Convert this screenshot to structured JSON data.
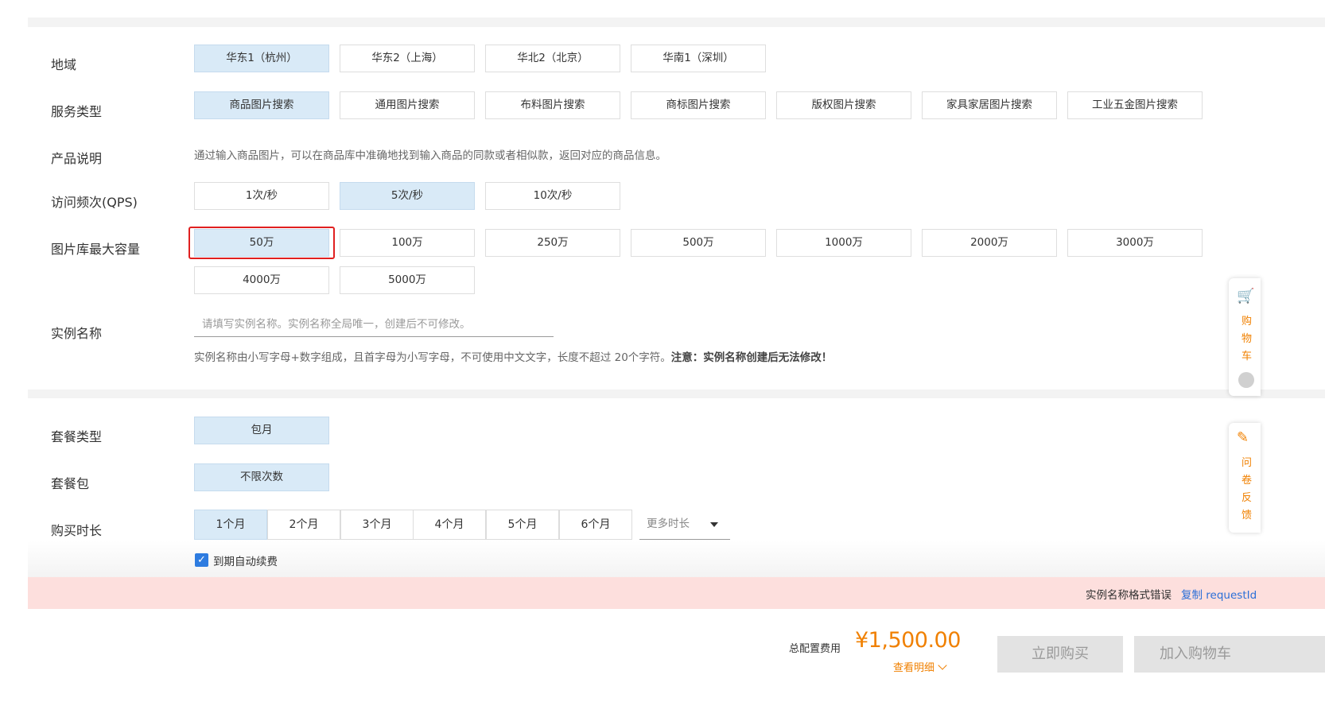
{
  "labels": {
    "region": "地域",
    "service_type": "服务类型",
    "product_desc": "产品说明",
    "qps": "访问频次(QPS)",
    "capacity": "图片库最大容量",
    "instance_name": "实例名称",
    "package_type": "套餐类型",
    "package": "套餐包",
    "duration": "购买时长"
  },
  "regions": [
    "华东1（杭州）",
    "华东2（上海）",
    "华北2（北京）",
    "华南1（深圳）"
  ],
  "service_types": [
    "商品图片搜索",
    "通用图片搜索",
    "布料图片搜索",
    "商标图片搜索",
    "版权图片搜索",
    "家具家居图片搜索",
    "工业五金图片搜索"
  ],
  "product_desc_text": "通过输入商品图片，可以在商品库中准确地找到输入商品的同款或者相似款，返回对应的商品信息。",
  "qps_options": [
    "1次/秒",
    "5次/秒",
    "10次/秒"
  ],
  "capacities": [
    "50万",
    "100万",
    "250万",
    "500万",
    "1000万",
    "2000万",
    "3000万",
    "4000万",
    "5000万"
  ],
  "instance": {
    "placeholder": "请填写实例名称。实例名称全局唯一，创建后不可修改。",
    "hint": "实例名称由小写字母+数字组成，且首字母为小写字母，不可使用中文文字，长度不超过 20个字符。",
    "hint_bold": "注意：实例名称创建后无法修改！"
  },
  "package_type_value": "包月",
  "package_value": "不限次数",
  "durations": [
    "1个月",
    "2个月",
    "3个月",
    "4个月",
    "5个月",
    "6个月"
  ],
  "more_duration": "更多时长",
  "auto_renew": "到期自动续费",
  "error": {
    "message": "实例名称格式错误",
    "copy_link": "复制 requestId"
  },
  "footer": {
    "total_label": "总配置费用",
    "price": "¥1,500.00",
    "detail": "查看明细",
    "buy_now": "立即购买",
    "add_cart": "加入购物车"
  },
  "sidebar": {
    "cart_text": "购物车",
    "feedback_text": "问卷反馈"
  },
  "colors": {
    "selected_bg": "#d9eaf7",
    "accent_orange": "#f08000",
    "link_blue": "#2a6fd8",
    "error_bg": "#fddfdd",
    "highlight_red": "#e02020"
  }
}
